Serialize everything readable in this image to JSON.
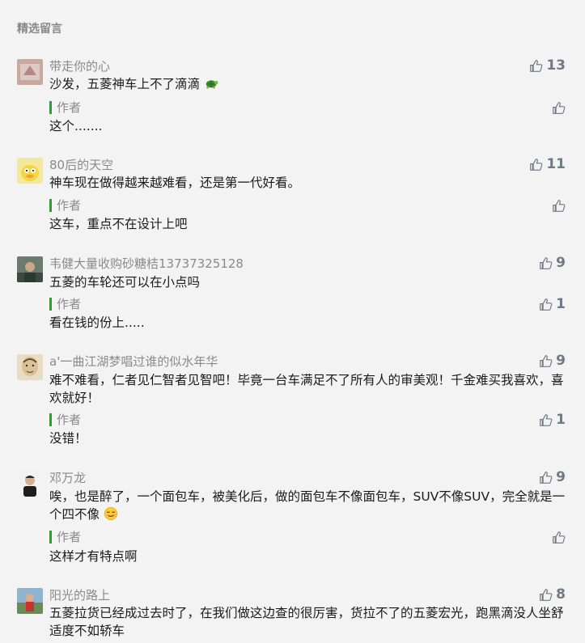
{
  "section_title": "精选留言",
  "author_label": "作者",
  "comments": [
    {
      "nickname": "带走你的心",
      "content": "沙发，五菱神车上不了滴滴",
      "emoji": "turtle",
      "likes": "13",
      "reply": "这个.......",
      "reply_likes": ""
    },
    {
      "nickname": "80后的天空",
      "content": "神车现在做得越来越难看，还是第一代好看。",
      "likes": "11",
      "reply": "这车，重点不在设计上吧",
      "reply_likes": ""
    },
    {
      "nickname": "韦健大量收购砂糖桔13737325128",
      "content": "五菱的车轮还可以在小点吗",
      "likes": "9",
      "reply": "看在钱的份上.....",
      "reply_likes": "1"
    },
    {
      "nickname": "a'一曲江湖梦唱过谁的似水年华",
      "content": "难不难看，仁者见仁智者见智吧！毕竟一台车满足不了所有人的审美观！千金难买我喜欢，喜欢就好！",
      "likes": "9",
      "reply": "没错！",
      "reply_likes": "1"
    },
    {
      "nickname": "邓万龙",
      "content": "唉，也是醉了，一个面包车，被美化后，做的面包车不像面包车，SUV不像SUV，完全就是一个四不像",
      "emoji": "smirk",
      "likes": "9",
      "reply": "这样才有特点啊",
      "reply_likes": ""
    },
    {
      "nickname": "阳光的路上",
      "content": "五菱拉货已经成过去时了，在我们做这边查的很厉害，货拉不了的五菱宏光，跑黑滴没人坐舒适度不如轿车",
      "likes": "8"
    }
  ],
  "colors": {
    "background": "#f3f3f3",
    "author_bar": "#1aad19",
    "like_icon": "#6e7a88",
    "nickname": "#8a8a8a"
  }
}
